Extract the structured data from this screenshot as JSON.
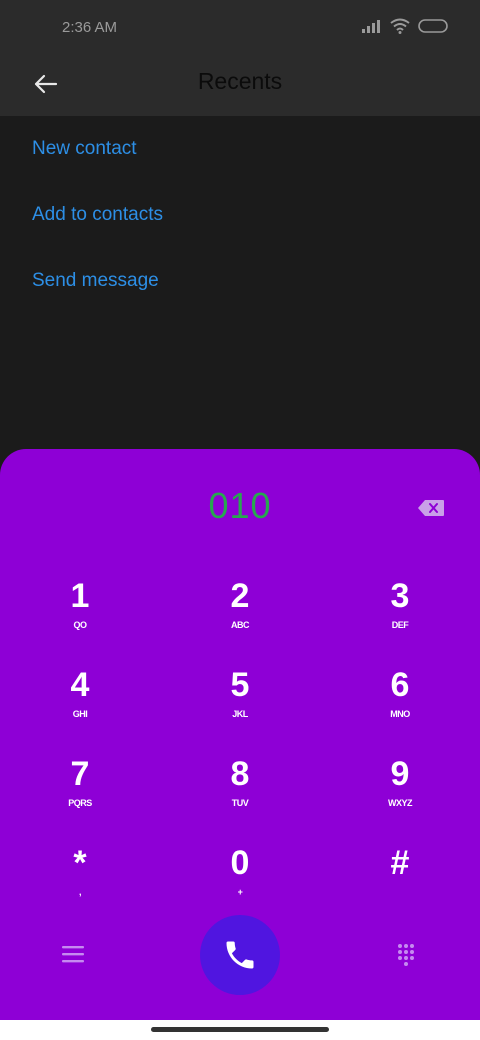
{
  "status_bar": {
    "time": "2:36 AM",
    "icons": [
      "signal-icon",
      "wifi-icon",
      "battery-icon"
    ]
  },
  "app_bar": {
    "title": "Recents",
    "back_icon": "arrow-left-icon"
  },
  "menu": {
    "items": [
      {
        "label": "New contact"
      },
      {
        "label": "Add to contacts"
      },
      {
        "label": "Send message"
      }
    ]
  },
  "dialer": {
    "number": "010",
    "backspace_icon": "backspace-icon",
    "keys": [
      {
        "digit": "1",
        "letters": "QO"
      },
      {
        "digit": "2",
        "letters": "ABC"
      },
      {
        "digit": "3",
        "letters": "DEF"
      },
      {
        "digit": "4",
        "letters": "GHI"
      },
      {
        "digit": "5",
        "letters": "JKL"
      },
      {
        "digit": "6",
        "letters": "MNO"
      },
      {
        "digit": "7",
        "letters": "PQRS"
      },
      {
        "digit": "8",
        "letters": "TUV"
      },
      {
        "digit": "9",
        "letters": "WXYZ"
      },
      {
        "digit": "*",
        "letters": ","
      },
      {
        "digit": "0",
        "letters": "+"
      },
      {
        "digit": "#",
        "letters": ""
      }
    ],
    "bottom": {
      "menu_icon": "menu-icon",
      "call_icon": "phone-icon",
      "keypad_icon": "keypad-icon"
    }
  },
  "colors": {
    "background": "#1b1b1b",
    "app_bar": "#2b2b2b",
    "link": "#2d8fe6",
    "dialer_bg": "#8e00d6",
    "number": "#27a84f",
    "call_button": "#5015e0"
  }
}
